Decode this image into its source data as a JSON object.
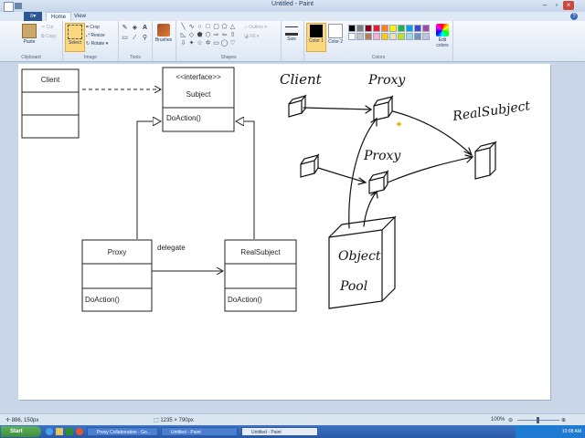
{
  "window": {
    "title": "Untitled - Paint"
  },
  "tabs": {
    "file": "",
    "home": "Home",
    "view": "View"
  },
  "ribbon": {
    "clipboard": {
      "label": "Clipboard",
      "paste": "Paste",
      "cut": "Cut",
      "copy": "Copy"
    },
    "image": {
      "label": "Image",
      "select": "Select",
      "crop": "Crop",
      "resize": "Resize",
      "rotate": "Rotate"
    },
    "tools": {
      "label": "Tools"
    },
    "shapes": {
      "label": "Shapes",
      "outline": "Outline",
      "fill": "Fill"
    },
    "brushes": "Brushes",
    "size": "Size",
    "colors": {
      "label": "Colors",
      "color1": "Color 1",
      "color2": "Color 2",
      "edit": "Edit colors",
      "palette": [
        "#000000",
        "#7f7f7f",
        "#880015",
        "#ed1c24",
        "#ff7f27",
        "#fff200",
        "#22b14c",
        "#00a2e8",
        "#3f48cc",
        "#a349a4",
        "#ffffff",
        "#c3c3c3",
        "#b97a57",
        "#ffaec9",
        "#ffc90e",
        "#efe4b0",
        "#b5e61d",
        "#99d9ea",
        "#7092be",
        "#c8bfe7"
      ]
    }
  },
  "diagram": {
    "client": "Client",
    "subject_stereo": "<<interface>>",
    "subject": "Subject",
    "subject_op": "DoAction()",
    "proxy": "Proxy",
    "proxy_op": "DoAction()",
    "realsubject": "RealSubject",
    "realsubject_op": "DoAction()",
    "delegate": "delegate",
    "sketch": {
      "client": "Client",
      "proxy1": "Proxy",
      "proxy2": "Proxy",
      "realsubject": "RealSubject",
      "pool_line1": "Object",
      "pool_line2": "Pool"
    }
  },
  "status": {
    "cursor": "886, 150px",
    "size": "1235 × 790px",
    "zoom": "100%"
  },
  "taskbar": {
    "start": "Start",
    "tasks": [
      "Proxy Collaboration - Go...",
      "Untitled - Paint",
      "Untitled - Paint"
    ],
    "clock": "10:08 AM"
  }
}
